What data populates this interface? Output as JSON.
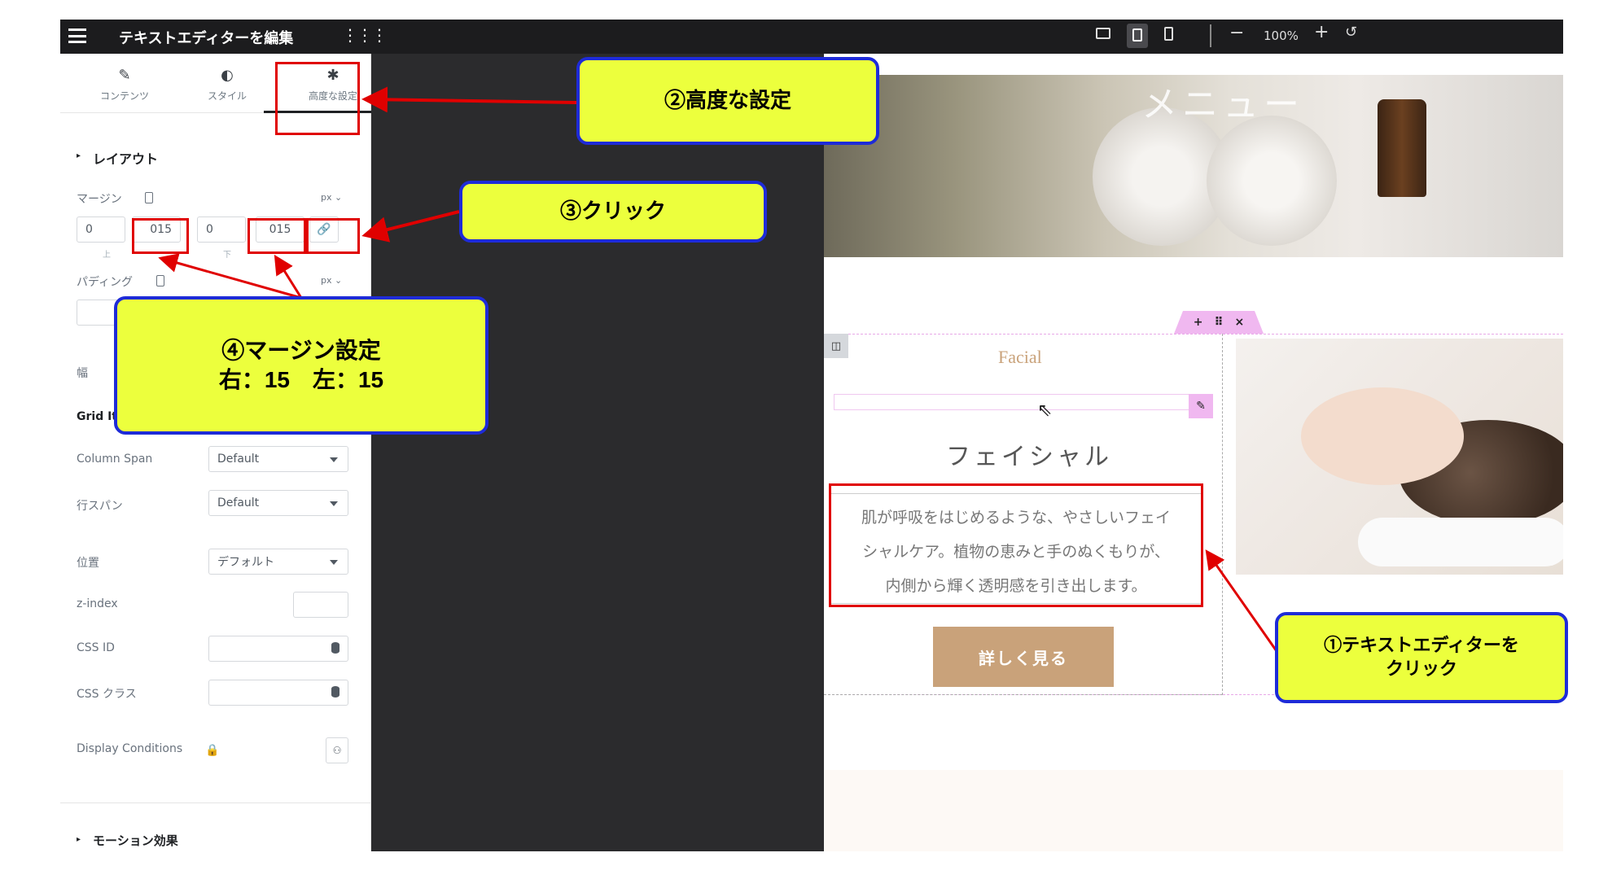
{
  "header": {
    "title": "テキストエディターを編集",
    "zoom": "100%"
  },
  "tabs": [
    {
      "label": "コンテンツ",
      "icon": "pencil-icon"
    },
    {
      "label": "スタイル",
      "icon": "half-circle-icon"
    },
    {
      "label": "高度な設定",
      "icon": "gear-icon"
    }
  ],
  "layout": {
    "section_label": "レイアウト",
    "margin_label": "マージン",
    "margin_unit": "px ⌄",
    "margin_values": [
      "0",
      "015",
      "0",
      "015"
    ],
    "margin_sub": [
      "上",
      "下"
    ],
    "padding_label": "パディング",
    "padding_unit": "px ⌄",
    "width_label": "幅",
    "grid_label": "Grid Ite",
    "column_span_label": "Column Span",
    "column_span_value": "Default",
    "row_span_label": "行スパン",
    "row_span_value": "Default",
    "position_label": "位置",
    "position_value": "デフォルト",
    "zindex_label": "z-index",
    "css_id_label": "CSS ID",
    "css_class_label": "CSS クラス",
    "display_conditions_label": "Display Conditions",
    "motion_label": "モーション効果"
  },
  "preview": {
    "hero_text": "メニュー",
    "facial_en": "Facial",
    "facial_jp": "フェイシャル",
    "description_lines": [
      "肌が呼吸をはじめるような、やさしいフェイ",
      "シャルケア。植物の恵みと手のぬくもりが、",
      "内側から輝く透明感を引き出します。"
    ],
    "button_label": "詳しく見る"
  },
  "callouts": {
    "c2": "②高度な設定",
    "c3": "③クリック",
    "c4_line1": "④マージン設定",
    "c4_line2": "右：15　左：15",
    "c1_line1": "①テキストエディターを",
    "c1_line2": "クリック"
  },
  "colors": {
    "callout_fill": "#ecff3d",
    "callout_border": "#1e2bd8",
    "highlight_red": "#e00000",
    "button_tan": "#c9a27a",
    "elementor_pink": "#f0b8f0"
  }
}
